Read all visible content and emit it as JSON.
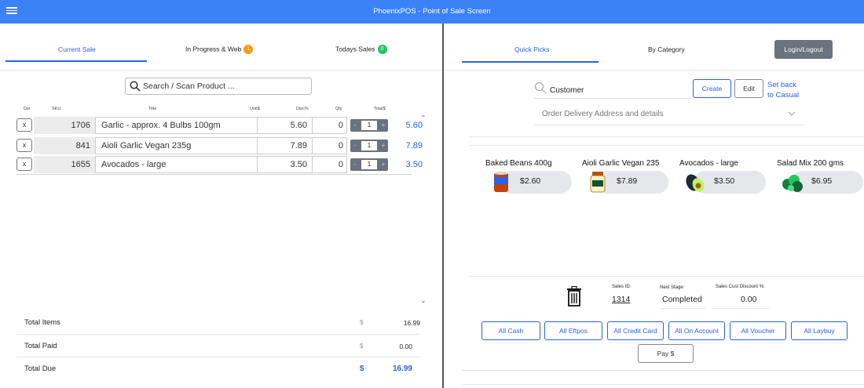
{
  "app": {
    "title": "PhoenixPOS - Point of Sale Screen"
  },
  "left_tabs": [
    {
      "label": "Current Sale"
    },
    {
      "label": "In Progress & Web",
      "badge": "1",
      "badge_color": "#f59e0b"
    },
    {
      "label": "Todays Sales",
      "badge": "0",
      "badge_color": "#22c55e"
    }
  ],
  "search": {
    "placeholder": "Search / Scan Product ..."
  },
  "columns": {
    "del": "Del",
    "sku": "SKU",
    "title": "Title",
    "unit": "Unit$",
    "disc": "Disc%",
    "qty": "Qty",
    "total": "Total$"
  },
  "rows": [
    {
      "del": "x",
      "sku": "1706",
      "title": "Garlic - approx. 4 Bulbs 100gm",
      "unit": "5.60",
      "disc": "0",
      "qty_minus": "-",
      "qty": "1",
      "qty_plus": "+",
      "total": "5.60"
    },
    {
      "del": "x",
      "sku": "841",
      "title": "Aioli Garlic Vegan 235g",
      "unit": "7.89",
      "disc": "0",
      "qty_minus": "-",
      "qty": "1",
      "qty_plus": "+",
      "total": "7.89"
    },
    {
      "del": "x",
      "sku": "1655",
      "title": "Avocados - large",
      "unit": "3.50",
      "disc": "0",
      "qty_minus": "-",
      "qty": "1",
      "qty_plus": "+",
      "total": "3.50"
    }
  ],
  "totals": {
    "items_label": "Total Items",
    "items_cur": "$",
    "items_value": "16.99",
    "paid_label": "Total Paid",
    "paid_cur": "$",
    "paid_value": "0.00",
    "due_label": "Total Due",
    "due_cur": "$",
    "due_value": "16.99"
  },
  "right_tabs": [
    {
      "label": "Quick Picks"
    },
    {
      "label": "By Category"
    }
  ],
  "login_label": "Login/Logout",
  "customer": {
    "value": "Customer",
    "create_label": "Create",
    "edit_label": "Edit",
    "set_back_line1": "Set back",
    "set_back_line2": "to Casual",
    "address_label": "Order Delivery Address and details"
  },
  "quick_picks": [
    {
      "name": "Baked Beans 400g",
      "price": "$2.60",
      "icon": "can-icon"
    },
    {
      "name": "Aioli Garlic Vegan 235",
      "price": "$7.89",
      "icon": "jar-icon"
    },
    {
      "name": "Avocados - large",
      "price": "$3.50",
      "icon": "avocado-icon"
    },
    {
      "name": "Salad Mix 200 gms",
      "price": "$6.95",
      "icon": "salad-icon"
    }
  ],
  "sale_info": {
    "sales_id_label": "Sales ID:",
    "sales_id": "1314",
    "next_stage_label": "Next Stage:",
    "next_stage": "Completed",
    "discount_label": "Sales Cust Discount %:",
    "discount": "0.00"
  },
  "payments": [
    {
      "label": "All Cash"
    },
    {
      "label": "All Eftpos"
    },
    {
      "label": "All Credit Card"
    },
    {
      "label": "All On Account"
    },
    {
      "label": "All Voucher"
    },
    {
      "label": "All Laybuy"
    }
  ],
  "pay_label": "Pay $",
  "colors": {
    "primary": "#3b82f6",
    "accent": "#2563eb",
    "grey_button": "#6b7280"
  }
}
